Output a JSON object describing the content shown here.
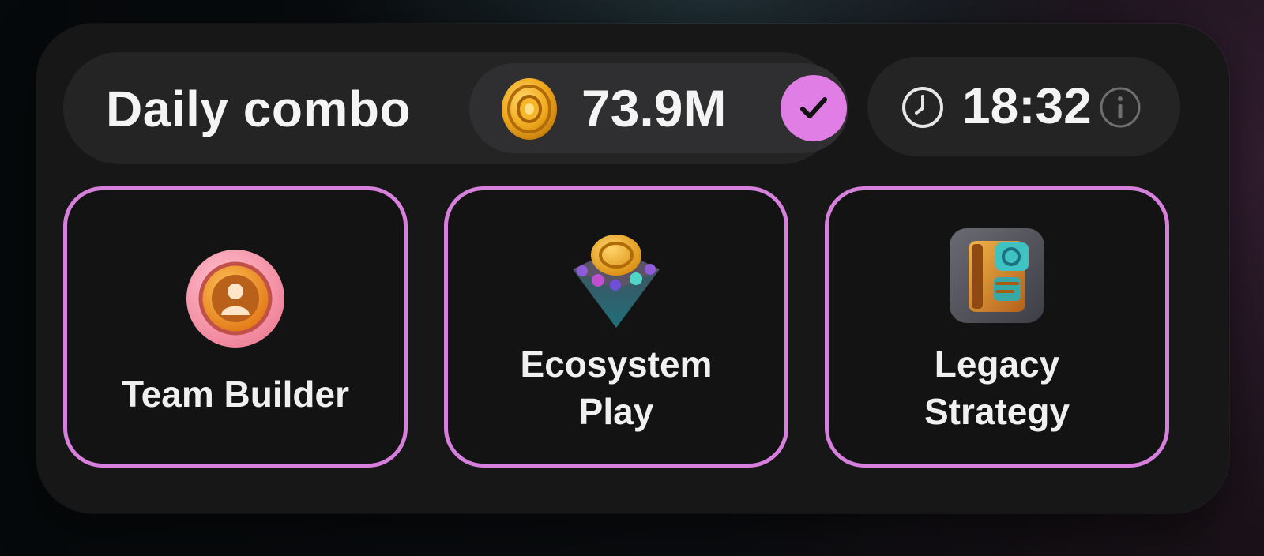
{
  "combo": {
    "title": "Daily combo",
    "reward_amount": "73.9M",
    "reward_icon": "coin-icon",
    "status_icon": "checkmark-icon",
    "accent_color": "#e07ee6"
  },
  "timer": {
    "time": "18:32",
    "clock_icon": "clock-icon",
    "info_icon": "info-icon"
  },
  "cards": [
    {
      "label": "Team Builder",
      "icon": "team-builder-icon"
    },
    {
      "label_line1": "Ecosystem",
      "label_line2": "Play",
      "icon": "ecosystem-play-icon"
    },
    {
      "label_line1": "Legacy",
      "label_line2": "Strategy",
      "icon": "legacy-strategy-icon"
    }
  ],
  "colors": {
    "card_border": "#d77fdc",
    "panel_bg": "#171718",
    "pill_bg": "#242425"
  }
}
